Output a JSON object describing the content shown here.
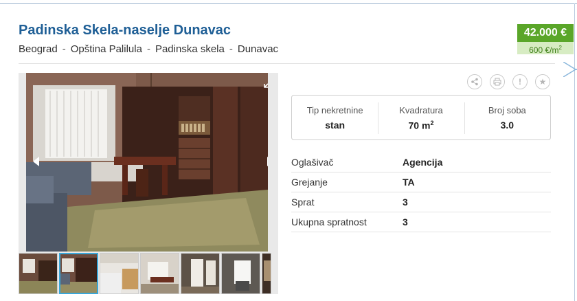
{
  "listing": {
    "title": "Padinska Skela-naselje Dunavac",
    "breadcrumb": [
      "Beograd",
      "Opština Palilula",
      "Padinska skela",
      "Dunavac"
    ],
    "breadcrumb_sep": "-",
    "price": "42.000 €",
    "price_per_m2": "600 €/m",
    "price_per_m2_sup": "2"
  },
  "gallery": {
    "thumbnail_count": 7,
    "active_thumbnail": 2
  },
  "actions": [
    {
      "name": "share-icon",
      "glyph": "⤴"
    },
    {
      "name": "print-icon",
      "glyph": "⎙"
    },
    {
      "name": "report-icon",
      "glyph": "!"
    },
    {
      "name": "favorite-icon",
      "glyph": "★"
    }
  ],
  "summary": [
    {
      "label": "Tip nekretnine",
      "value": "stan",
      "sup": ""
    },
    {
      "label": "Kvadratura",
      "value": "70 m",
      "sup": "2"
    },
    {
      "label": "Broj soba",
      "value": "3.0",
      "sup": ""
    }
  ],
  "details": [
    {
      "label": "Oglašivač",
      "value": "Agencija"
    },
    {
      "label": "Grejanje",
      "value": "TA"
    },
    {
      "label": "Sprat",
      "value": "3"
    },
    {
      "label": "Ukupna spratnost",
      "value": "3"
    }
  ],
  "colors": {
    "title": "#1f5f96",
    "price_bg": "#5aa629",
    "price_sub_bg": "#d7ecc3",
    "active_thumb_border": "#39a7d9"
  }
}
